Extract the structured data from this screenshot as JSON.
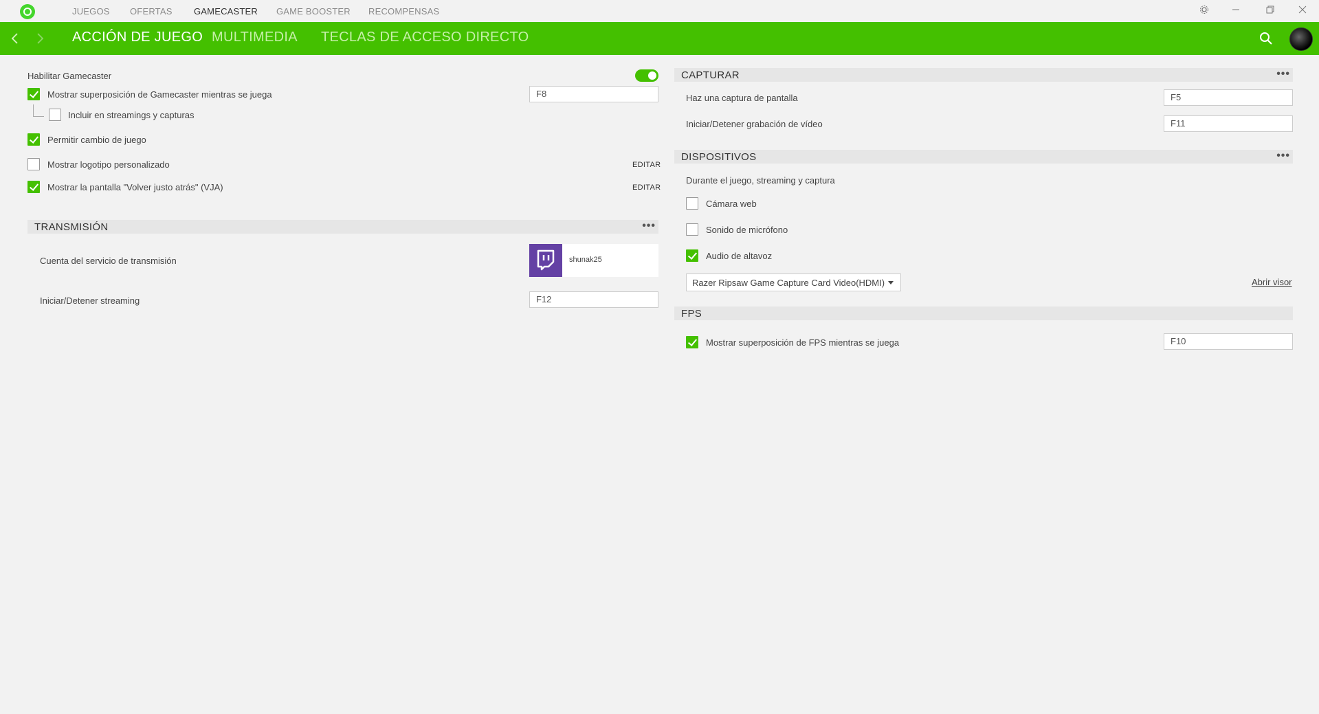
{
  "topnav": {
    "items": [
      "JUEGOS",
      "OFERTAS",
      "GAMECASTER",
      "GAME BOOSTER",
      "RECOMPENSAS"
    ],
    "active": "GAMECASTER"
  },
  "header": {
    "tabs": [
      "ACCIÓN DE JUEGO",
      "MULTIMEDIA",
      "TECLAS DE ACCESO DIRECTO"
    ],
    "active": "ACCIÓN DE JUEGO"
  },
  "left": {
    "enable_label": "Habilitar Gamecaster",
    "enable_on": true,
    "options": [
      {
        "label": "Mostrar superposición de Gamecaster mientras se juega",
        "checked": true,
        "key": "F8"
      },
      {
        "label": "Incluir en streamings y capturas",
        "checked": false
      },
      {
        "label": "Permitir cambio de juego",
        "checked": true
      },
      {
        "label": "Mostrar logotipo personalizado",
        "checked": false,
        "action": "EDITAR"
      },
      {
        "label": "Mostrar la pantalla \"Volver justo atrás\" (VJA)",
        "checked": true,
        "action": "EDITAR"
      }
    ],
    "transmission": {
      "title": "TRANSMISIÓN",
      "account_label": "Cuenta del servicio de transmisión",
      "account_user": "shunak25",
      "stream_label": "Iniciar/Detener streaming",
      "stream_key": "F12"
    }
  },
  "right": {
    "capture": {
      "title": "CAPTURAR",
      "rows": [
        {
          "label": "Haz una captura de pantalla",
          "key": "F5"
        },
        {
          "label": "Iniciar/Detener grabación de vídeo",
          "key": "F11"
        }
      ]
    },
    "devices": {
      "title": "DISPOSITIVOS",
      "subtitle": "Durante el juego, streaming y captura",
      "items": [
        {
          "label": "Cámara web",
          "checked": false
        },
        {
          "label": "Sonido de micrófono",
          "checked": false
        },
        {
          "label": "Audio de altavoz",
          "checked": true
        }
      ],
      "source": "Razer Ripsaw Game Capture Card Video(HDMI)",
      "open_viewer": "Abrir visor"
    },
    "fps": {
      "title": "FPS",
      "label": "Mostrar superposición de FPS mientras se juega",
      "checked": true,
      "key": "F10"
    }
  },
  "colors": {
    "accent": "#44c000",
    "twitch": "#6441a4"
  }
}
